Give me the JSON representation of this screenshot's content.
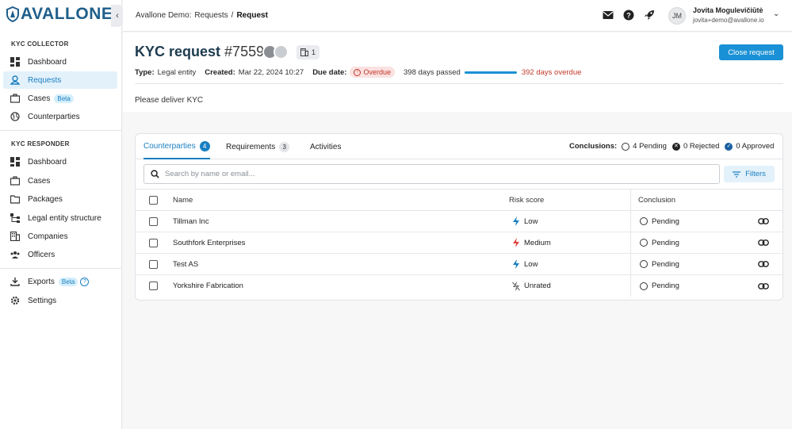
{
  "brand": {
    "name": "AVALLONE",
    "color": "#1f5f8b"
  },
  "sidebar": {
    "collector_title": "KYC COLLECTOR",
    "collector_items": [
      {
        "label": "Dashboard",
        "icon": "dashboard-icon"
      },
      {
        "label": "Requests",
        "icon": "requests-icon",
        "active": true
      },
      {
        "label": "Cases",
        "icon": "briefcase-icon",
        "badge": "Beta"
      },
      {
        "label": "Counterparties",
        "icon": "globe-icon"
      }
    ],
    "responder_title": "KYC RESPONDER",
    "responder_items": [
      {
        "label": "Dashboard",
        "icon": "dashboard-icon"
      },
      {
        "label": "Cases",
        "icon": "briefcase-icon"
      },
      {
        "label": "Packages",
        "icon": "folder-icon"
      },
      {
        "label": "Legal entity structure",
        "icon": "structure-icon"
      },
      {
        "label": "Companies",
        "icon": "building-icon"
      },
      {
        "label": "Officers",
        "icon": "people-icon"
      }
    ],
    "bottom_items": [
      {
        "label": "Exports",
        "icon": "download-icon",
        "badge": "Beta"
      },
      {
        "label": "Settings",
        "icon": "gear-icon"
      }
    ]
  },
  "topbar": {
    "crumb_root": "Avallone Demo:",
    "crumb_requests": "Requests",
    "crumb_sep": "/",
    "crumb_current": "Request",
    "user_initials": "JM",
    "user_name": "Jovita Mogulevičiūtė",
    "user_email": "jovita+demo@avallone.io"
  },
  "request": {
    "title": "KYC request",
    "number": "#7559",
    "org_count": "1",
    "close_label": "Close request",
    "type_label": "Type:",
    "type_value": "Legal entity",
    "created_label": "Created:",
    "created_value": "Mar 22, 2024 10:27",
    "due_label": "Due date:",
    "due_status": "Overdue",
    "days_passed": "398 days passed",
    "days_overdue": "392 days overdue",
    "description": "Please deliver KYC"
  },
  "tabs": [
    {
      "label": "Counterparties",
      "count": "4"
    },
    {
      "label": "Requirements",
      "count": "3"
    },
    {
      "label": "Activities"
    }
  ],
  "conclusions": {
    "label": "Conclusions:",
    "pending": "4 Pending",
    "rejected": "0 Rejected",
    "approved": "0 Approved"
  },
  "search": {
    "placeholder": "Search by name or email..."
  },
  "filters_label": "Filters",
  "table": {
    "headers": {
      "name": "Name",
      "risk": "Risk score",
      "conclusion": "Conclusion"
    },
    "rows": [
      {
        "name": "Tillman Inc",
        "risk": "Low",
        "risk_color": "#1a7fc1",
        "conclusion": "Pending"
      },
      {
        "name": "Southfork Enterprises",
        "risk": "Medium",
        "risk_color": "#e0463f",
        "conclusion": "Pending"
      },
      {
        "name": "Test AS",
        "risk": "Low",
        "risk_color": "#1a7fc1",
        "conclusion": "Pending"
      },
      {
        "name": "Yorkshire Fabrication",
        "risk": "Unrated",
        "risk_color": "#555555",
        "conclusion": "Pending"
      }
    ]
  }
}
